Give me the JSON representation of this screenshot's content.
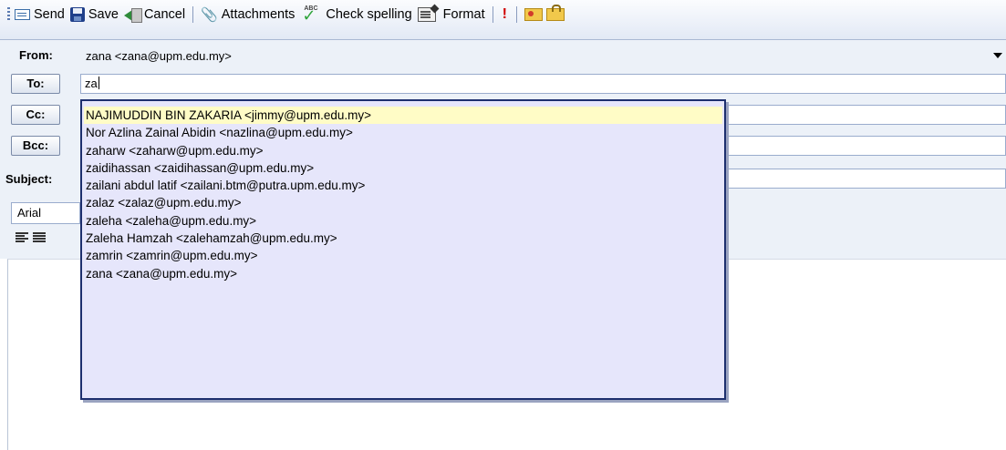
{
  "toolbar": {
    "send": "Send",
    "save": "Save",
    "cancel": "Cancel",
    "attachments": "Attachments",
    "check_spelling": "Check spelling",
    "format": "Format",
    "icons": [
      "send-icon",
      "save-icon",
      "cancel-icon",
      "paperclip-icon",
      "spellcheck-icon",
      "format-icon",
      "importance-icon",
      "certificate-icon",
      "encrypt-icon"
    ]
  },
  "header": {
    "from_label": "From:",
    "from_value": "zana <zana@upm.edu.my>",
    "to_button": "To:",
    "to_value": "za",
    "cc_button": "Cc:",
    "cc_value": "",
    "bcc_button": "Bcc:",
    "bcc_value": "",
    "subject_label": "Subject:",
    "subject_value": "",
    "font_value": "Arial"
  },
  "autocomplete": {
    "selected_index": 0,
    "items": [
      "NAJIMUDDIN BIN ZAKARIA <jimmy@upm.edu.my>",
      "Nor Azlina Zainal Abidin <nazlina@upm.edu.my>",
      "zaharw <zaharw@upm.edu.my>",
      "zaidihassan <zaidihassan@upm.edu.my>",
      "zailani abdul latif <zailani.btm@putra.upm.edu.my>",
      "zalaz <zalaz@upm.edu.my>",
      "zaleha <zaleha@upm.edu.my>",
      "Zaleha Hamzah <zalehamzah@upm.edu.my>",
      "zamrin <zamrin@upm.edu.my>",
      "zana <zana@upm.edu.my>"
    ]
  },
  "colors": {
    "dropdown_bg": "#e6e6fb",
    "dropdown_border": "#1d2f6e",
    "selected_bg": "#fffcc6",
    "header_bg": "#ecf1f8"
  }
}
